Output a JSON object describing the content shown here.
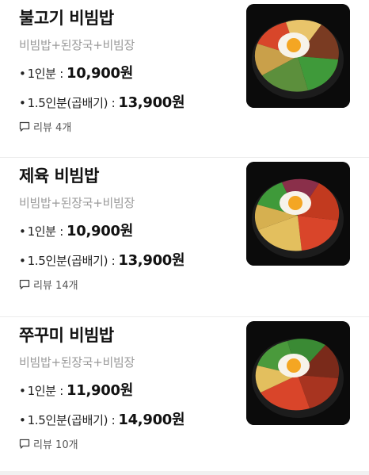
{
  "items": [
    {
      "name": "불고기 비빔밥",
      "desc": "비빔밥+된장국+비빔장",
      "bullet": "•",
      "option1_label": "1인분 :",
      "option1_price": "10,900원",
      "option2_label": "1.5인분(곱배기) :",
      "option2_price": "13,900원",
      "review_label": "리뷰 4개",
      "image_label": "불고기 비빔밥 사진"
    },
    {
      "name": "제육 비빔밥",
      "desc": "비빔밥+된장국+비빔장",
      "bullet": "•",
      "option1_label": "1인분 :",
      "option1_price": "10,900원",
      "option2_label": "1.5인분(곱배기) :",
      "option2_price": "13,900원",
      "review_label": "리뷰 14개",
      "image_label": "제육 비빔밥 사진"
    },
    {
      "name": "쭈꾸미 비빔밥",
      "desc": "비빔밥+된장국+비빔장",
      "bullet": "•",
      "option1_label": "1인분 :",
      "option1_price": "11,900원",
      "option2_label": "1.5인분(곱배기) :",
      "option2_price": "14,900원",
      "review_label": "리뷰 10개",
      "image_label": "쭈꾸미 비빔밥 사진"
    }
  ],
  "icons": {
    "review": "speech-bubble-icon"
  },
  "colors": {
    "text_primary": "#111111",
    "text_secondary": "#9a9a9a",
    "divider": "#ececec",
    "thumb_bg": "#0b0b0b"
  }
}
